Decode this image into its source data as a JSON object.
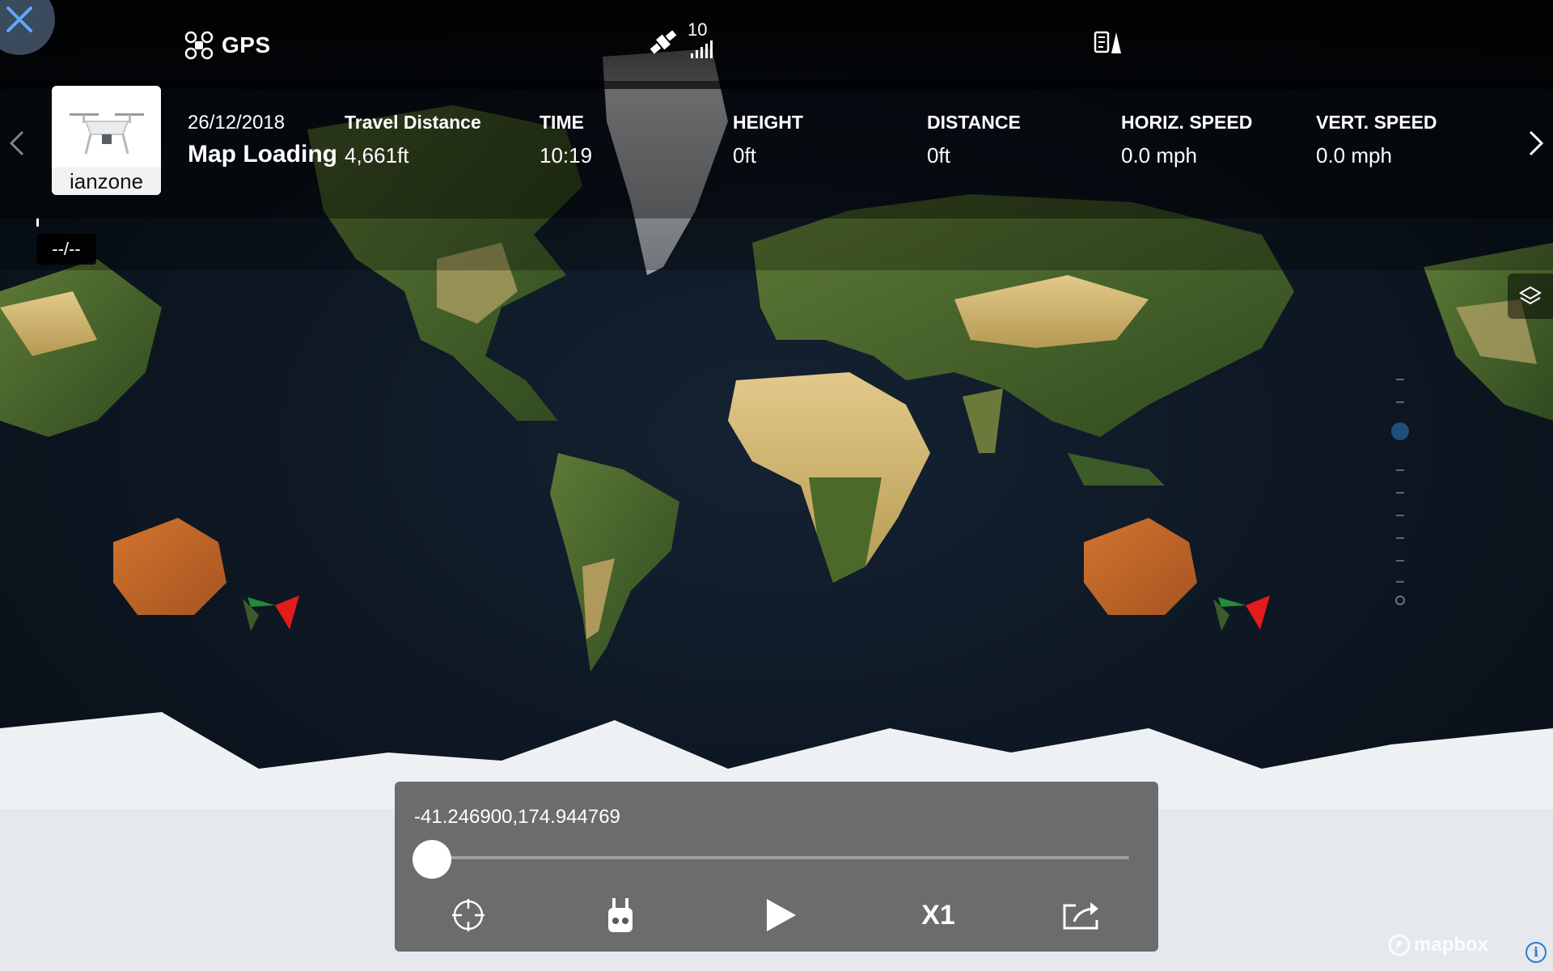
{
  "header": {
    "mode_label": "GPS",
    "satellite_count": "10"
  },
  "drone": {
    "name": "ianzone"
  },
  "telemetry": {
    "date": "26/12/2018",
    "status": "Map Loading",
    "travel_distance": {
      "label": "Travel Distance",
      "value": "4,661ft"
    },
    "time": {
      "label": "TIME",
      "value": "10:19"
    },
    "height": {
      "label": "HEIGHT",
      "value": "0ft"
    },
    "distance": {
      "label": "DISTANCE",
      "value": "0ft"
    },
    "horiz_speed": {
      "label": "HORIZ. SPEED",
      "value": "0.0 mph"
    },
    "vert_speed": {
      "label": "VERT. SPEED",
      "value": "0.0 mph"
    }
  },
  "timeline": {
    "date_badge": "--/--"
  },
  "playback": {
    "coordinates": "-41.246900,174.944769",
    "progress": 0,
    "speed_label": "X1"
  },
  "map": {
    "attribution": "mapbox"
  },
  "icons": {
    "close": "close-icon",
    "drone": "drone-icon",
    "satellite": "satellite-icon",
    "signal": "signal-bars-icon",
    "compass": "compass-icon",
    "layers": "layers-icon",
    "locate": "crosshair-icon",
    "remote": "remote-controller-icon",
    "play": "play-icon",
    "share": "share-icon",
    "info": "info-icon"
  },
  "colors": {
    "ocean": "#0c1724",
    "land": "#556b2f",
    "ice": "#eef1f4",
    "aircraft_marker": "#e21b1b",
    "zoom_knob": "#1e4f7a",
    "close_bg": "#3b4a5c"
  }
}
